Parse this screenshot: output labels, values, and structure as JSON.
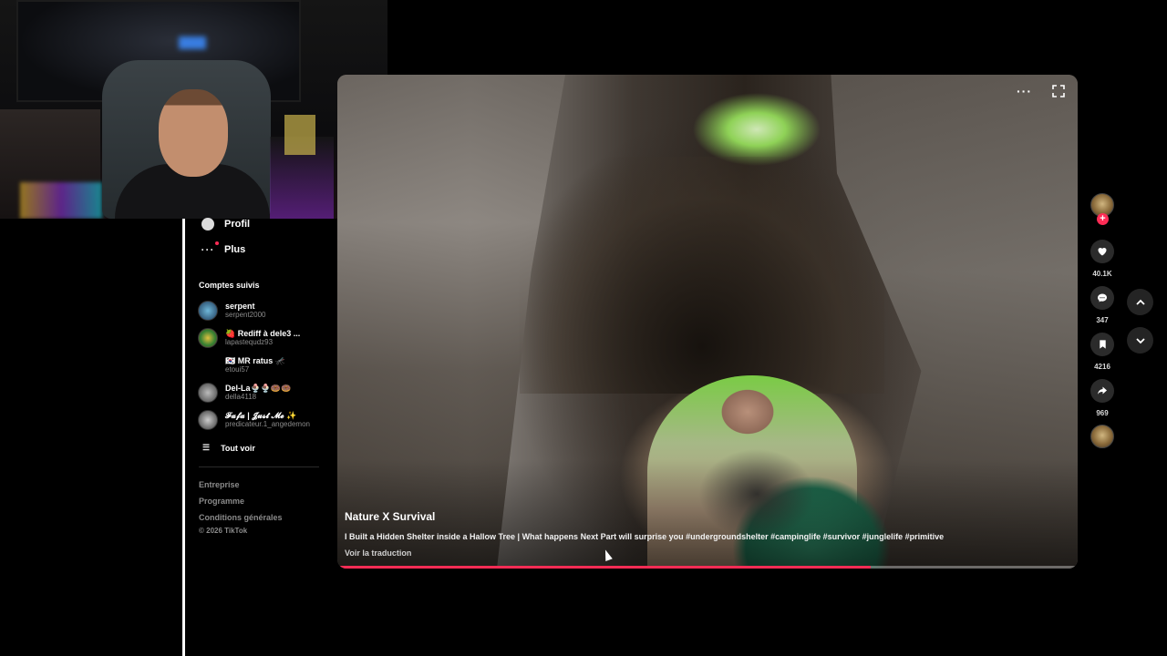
{
  "sidebar": {
    "nav": [
      {
        "label": "Profil",
        "icon": "profile-icon"
      },
      {
        "label": "Plus",
        "icon": "more-icon"
      }
    ],
    "followed_title": "Comptes suivis",
    "accounts": [
      {
        "name": "serpent",
        "username": "serpent2000"
      },
      {
        "name": "🍓 Rediff à dele3 ...",
        "username": "lapastequdz93"
      },
      {
        "name": "🇰🇷 MR ratus 🦟",
        "username": "etoui57"
      },
      {
        "name": "Del-La🍨🍨🍩🍩",
        "username": "della4118"
      },
      {
        "name": "𝓕𝓪𝓯𝓪 | 𝓙𝓾𝓼𝓽 𝓜𝓮 ✨",
        "username": "predicateur.1_angedemon"
      }
    ],
    "see_all": "Tout voir",
    "footer_links": [
      "Entreprise",
      "Programme",
      "Conditions générales"
    ],
    "copyright": "© 2026 TikTok"
  },
  "video": {
    "author": "Nature X Survival",
    "description": "I Built a Hidden Shelter inside a Hallow Tree | What happens Next Part will surprise you #undergroundshelter #campinglife #survivor #junglelife #primitive",
    "translate": "Voir la traduction",
    "progress_fraction": 0.72
  },
  "actions": {
    "likes": "40.1K",
    "comments": "347",
    "saves": "4216",
    "shares": "969"
  },
  "colors": {
    "accent": "#fe2c55",
    "background": "#000000"
  }
}
